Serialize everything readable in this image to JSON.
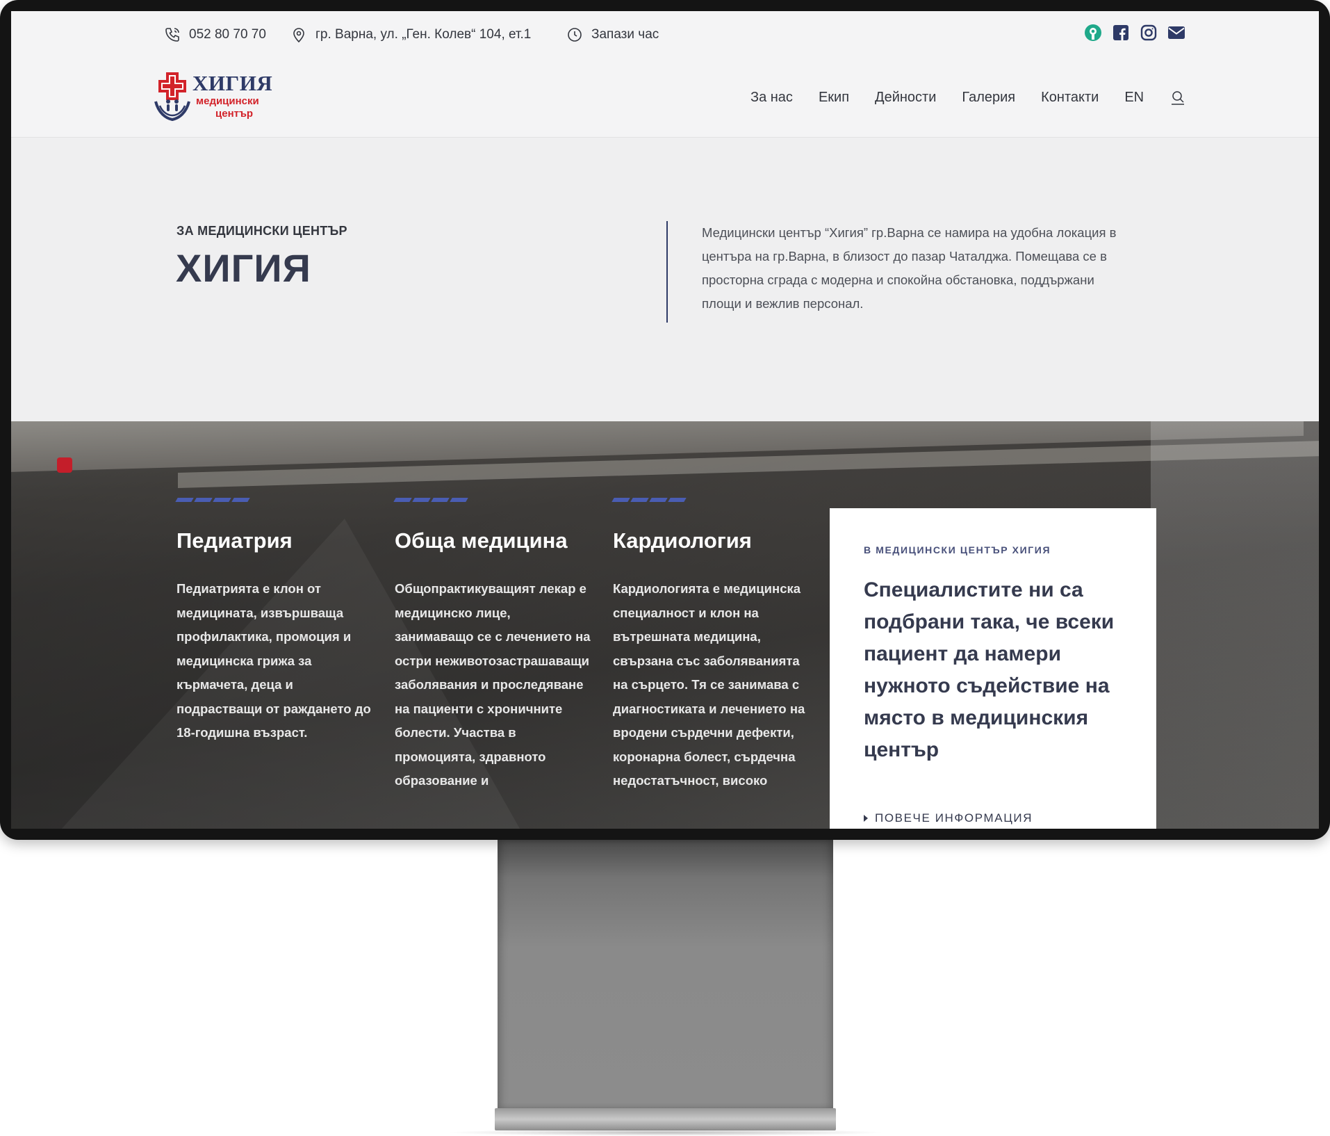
{
  "topbar": {
    "phone": "052 80 70 70",
    "address": "гр. Варна, ул. „Ген. Колев“ 104, ет.1",
    "booking": "Запази час"
  },
  "social": [
    "superdoc-icon",
    "facebook-icon",
    "instagram-icon",
    "mail-icon"
  ],
  "logo": {
    "name": "ХИГИЯ",
    "line1": "медицински",
    "line2": "център"
  },
  "nav": {
    "items": [
      "За нас",
      "Екип",
      "Дейности",
      "Галерия",
      "Контакти",
      "EN"
    ]
  },
  "intro": {
    "kicker": "ЗА МЕДИЦИНСКИ ЦЕНТЪР",
    "title": "ХИГИЯ",
    "text": "Медицински център “Хигия” гр.Варна се намира на удобна локация в центъра на гр.Варна, в близост до пазар Чаталджа. Помещава се в просторна сграда с модерна и спокойна обстановка, поддържани площи и вежлив персонал."
  },
  "services": [
    {
      "title": "Педиатрия",
      "text": "Педиатрията е клон от медицината, извършваща профилактика, промоция и медицинска грижа за кърмачета, деца и подрастващи от раждането до 18-годишна възраст."
    },
    {
      "title": "Обща медицина",
      "text": "Общопрактикуващият лекар е медицинско лице, занимаващо се с лечението на остри неживотозастрашаващи заболявания и проследяване на пациенти с хроничните болести. Участва в промоцията, здравното образование и"
    },
    {
      "title": "Кардиология",
      "text": "Кардиологията е медицинска специалност и клон на вътрешната медицина, свързана със заболяванията на сърцето. Тя се занимава с диагностиката и лечението на вродени сърдечни дефекти, коронарна болест, сърдечна недостатъчност, високо"
    }
  ],
  "promo": {
    "kicker": "В МЕДИЦИНСКИ ЦЕНТЪР ХИГИЯ",
    "title": "Специалистите ни са подбрани така, че всеки пациент да намери нужното съдействие на място в медицинския център",
    "link": "ПОВЕЧЕ ИНФОРМАЦИЯ"
  },
  "colors": {
    "accent": "#4a5db3",
    "brand_red": "#d2232a",
    "brand_navy": "#2e3a67",
    "text_dark": "#353a4e"
  }
}
